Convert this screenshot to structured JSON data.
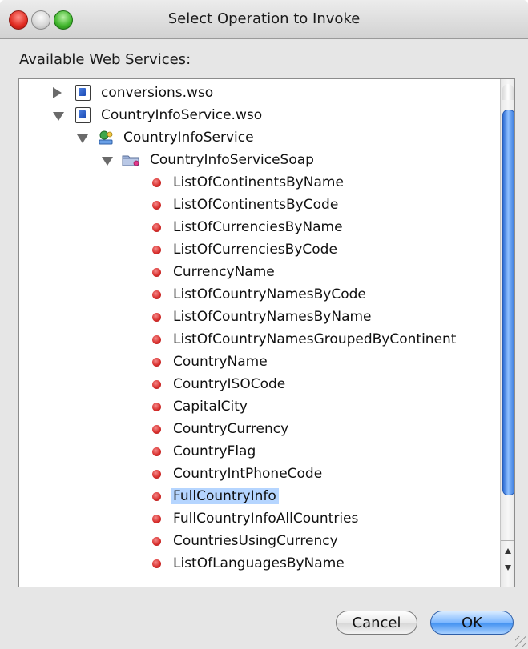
{
  "window": {
    "title": "Select Operation to Invoke"
  },
  "section_label": "Available Web Services:",
  "tree": [
    {
      "label": "conversions.wso",
      "level": 0,
      "state": "collapsed",
      "icon": "wso-file-icon"
    },
    {
      "label": "CountryInfoService.wso",
      "level": 0,
      "state": "expanded",
      "icon": "wso-file-icon"
    },
    {
      "label": "CountryInfoService",
      "level": 1,
      "state": "expanded",
      "icon": "web-service-icon"
    },
    {
      "label": "CountryInfoServiceSoap",
      "level": 2,
      "state": "expanded",
      "icon": "port-folder-icon"
    },
    {
      "label": "ListOfContinentsByName",
      "level": 3,
      "state": "leaf",
      "icon": "operation-icon"
    },
    {
      "label": "ListOfContinentsByCode",
      "level": 3,
      "state": "leaf",
      "icon": "operation-icon"
    },
    {
      "label": "ListOfCurrenciesByName",
      "level": 3,
      "state": "leaf",
      "icon": "operation-icon"
    },
    {
      "label": "ListOfCurrenciesByCode",
      "level": 3,
      "state": "leaf",
      "icon": "operation-icon"
    },
    {
      "label": "CurrencyName",
      "level": 3,
      "state": "leaf",
      "icon": "operation-icon"
    },
    {
      "label": "ListOfCountryNamesByCode",
      "level": 3,
      "state": "leaf",
      "icon": "operation-icon"
    },
    {
      "label": "ListOfCountryNamesByName",
      "level": 3,
      "state": "leaf",
      "icon": "operation-icon"
    },
    {
      "label": "ListOfCountryNamesGroupedByContinent",
      "level": 3,
      "state": "leaf",
      "icon": "operation-icon"
    },
    {
      "label": "CountryName",
      "level": 3,
      "state": "leaf",
      "icon": "operation-icon"
    },
    {
      "label": "CountryISOCode",
      "level": 3,
      "state": "leaf",
      "icon": "operation-icon"
    },
    {
      "label": "CapitalCity",
      "level": 3,
      "state": "leaf",
      "icon": "operation-icon"
    },
    {
      "label": "CountryCurrency",
      "level": 3,
      "state": "leaf",
      "icon": "operation-icon"
    },
    {
      "label": "CountryFlag",
      "level": 3,
      "state": "leaf",
      "icon": "operation-icon"
    },
    {
      "label": "CountryIntPhoneCode",
      "level": 3,
      "state": "leaf",
      "icon": "operation-icon"
    },
    {
      "label": "FullCountryInfo",
      "level": 3,
      "state": "leaf",
      "icon": "operation-icon",
      "selected": true
    },
    {
      "label": "FullCountryInfoAllCountries",
      "level": 3,
      "state": "leaf",
      "icon": "operation-icon"
    },
    {
      "label": "CountriesUsingCurrency",
      "level": 3,
      "state": "leaf",
      "icon": "operation-icon"
    },
    {
      "label": "ListOfLanguagesByName",
      "level": 3,
      "state": "leaf",
      "icon": "operation-icon"
    }
  ],
  "buttons": {
    "cancel_label": "Cancel",
    "ok_label": "OK"
  },
  "colors": {
    "selection": "#b5d5ff",
    "scroll_thumb": "#3477dc",
    "operation_dot": "#d9302e"
  }
}
